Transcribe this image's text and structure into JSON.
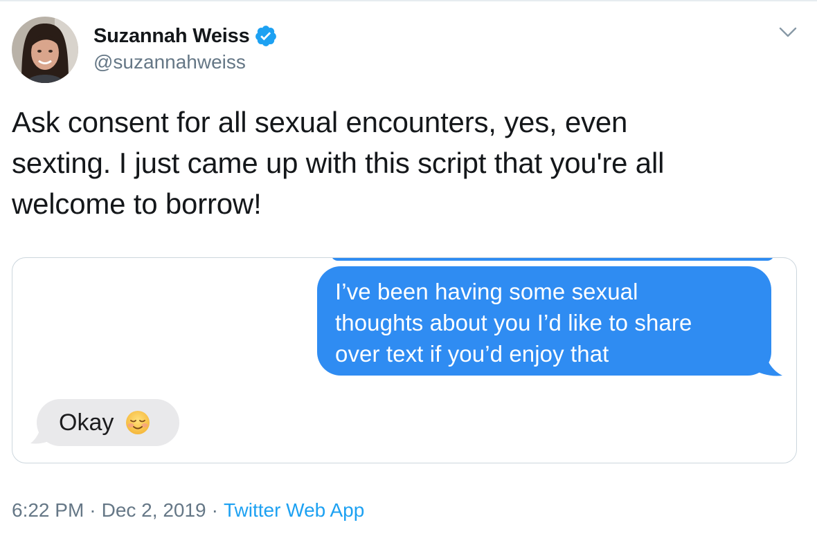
{
  "author": {
    "display_name": "Suzannah Weiss",
    "handle": "@suzannahweiss",
    "verified": true,
    "avatar_icon": "profile-photo"
  },
  "tweet": {
    "text": "Ask consent for all sexual encounters, yes, even\nsexting. I just came up with this script that you're all\nwelcome to borrow!"
  },
  "media": {
    "sent_message": "I’ve been having some sexual\nthoughts about you I’d like to share\nover text if you’d enjoy that",
    "received_message": "Okay",
    "received_emoji": "smiling-face-icon"
  },
  "meta": {
    "time": "6:22 PM",
    "separator": "·",
    "date": "Dec 2, 2019",
    "source": "Twitter Web App"
  },
  "colors": {
    "imessage_blue": "#2f8cf2",
    "imessage_gray": "#e9e9eb",
    "twitter_blue": "#1da1f2",
    "secondary_text": "#657786"
  }
}
